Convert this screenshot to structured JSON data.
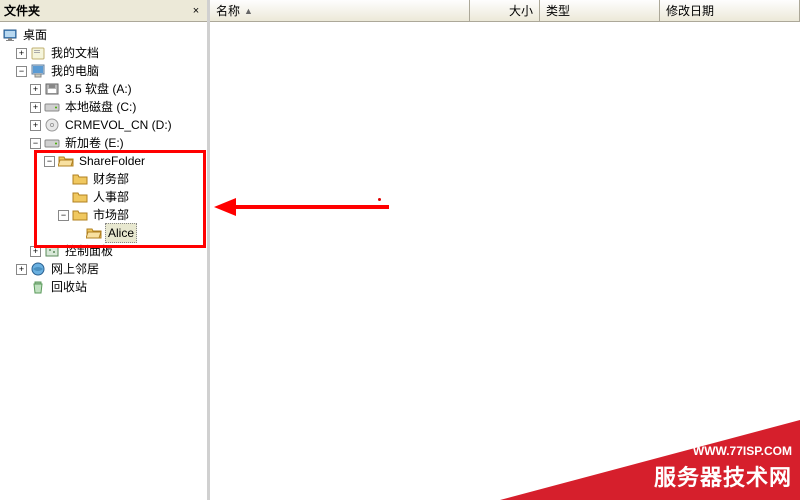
{
  "panel": {
    "title": "文件夹",
    "close": "×"
  },
  "expanders": {
    "plus": "+",
    "minus": "−"
  },
  "tree": {
    "desktop": "桌面",
    "mydocs": "我的文档",
    "mycomputer": "我的电脑",
    "floppy": "3.5 软盘 (A:)",
    "localc": "本地磁盘 (C:)",
    "crmevol": "CRMEVOL_CN (D:)",
    "newvol": "新加卷 (E:)",
    "sharefolder": "ShareFolder",
    "finance": "财务部",
    "hr": "人事部",
    "marketing": "市场部",
    "alice": "Alice",
    "controlpanel": "控制面板",
    "network": "网上邻居",
    "recycle": "回收站"
  },
  "columns": {
    "name": "名称",
    "size": "大小",
    "type": "类型",
    "modified": "修改日期"
  },
  "watermark": {
    "url": "WWW.77ISP.COM",
    "brand": "服务器技术网"
  }
}
